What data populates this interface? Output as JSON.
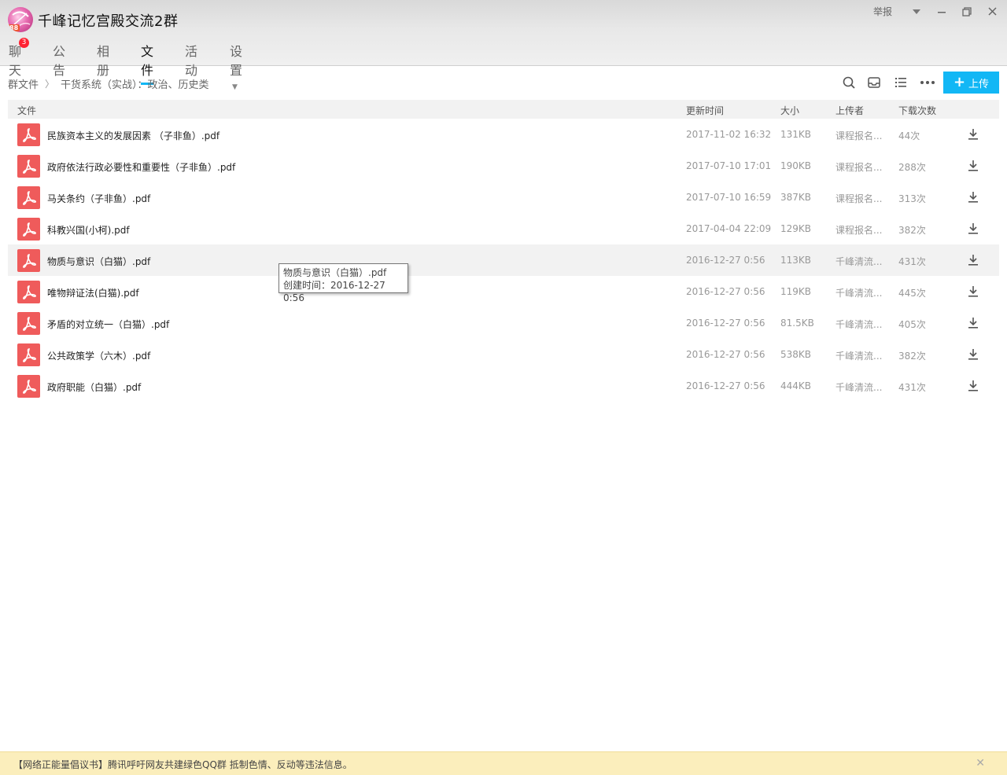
{
  "header": {
    "group_name": "千峰记忆宫殿交流2群",
    "avatar_level": "88",
    "report_label": "举报",
    "tabs": [
      {
        "label": "聊天",
        "badge": "3"
      },
      {
        "label": "公告"
      },
      {
        "label": "相册"
      },
      {
        "label": "文件",
        "active": true
      },
      {
        "label": "活动"
      },
      {
        "label": "设置"
      }
    ]
  },
  "toolbar": {
    "breadcrumb": [
      "群文件",
      "干货系统（实战）：政治、历史类"
    ],
    "upload_label": "上传",
    "accent_color": "#12b7f5"
  },
  "table": {
    "columns": [
      "文件",
      "更新时间",
      "大小",
      "上传者",
      "下载次数"
    ],
    "rows": [
      {
        "name": "民族资本主义的发展因素 （子非鱼）.pdf",
        "time": "2017-11-02 16:32",
        "size": "131KB",
        "uploader": "课程报名...",
        "count": "44次"
      },
      {
        "name": "政府依法行政必要性和重要性（子非鱼）.pdf",
        "time": "2017-07-10 17:01",
        "size": "190KB",
        "uploader": "课程报名...",
        "count": "288次"
      },
      {
        "name": "马关条约（子非鱼）.pdf",
        "time": "2017-07-10 16:59",
        "size": "387KB",
        "uploader": "课程报名...",
        "count": "313次"
      },
      {
        "name": "科教兴国(小柯).pdf",
        "time": "2017-04-04 22:09",
        "size": "129KB",
        "uploader": "课程报名...",
        "count": "382次"
      },
      {
        "name": "物质与意识（白猫）.pdf",
        "time": "2016-12-27 0:56",
        "size": "113KB",
        "uploader": "千峰清流...",
        "count": "431次"
      },
      {
        "name": "唯物辩证法(白猫).pdf",
        "time": "2016-12-27 0:56",
        "size": "119KB",
        "uploader": "千峰清流...",
        "count": "445次"
      },
      {
        "name": "矛盾的对立统一（白猫）.pdf",
        "time": "2016-12-27 0:56",
        "size": "81.5KB",
        "uploader": "千峰清流...",
        "count": "405次"
      },
      {
        "name": "公共政策学（六木）.pdf",
        "time": "2016-12-27 0:56",
        "size": "538KB",
        "uploader": "千峰清流...",
        "count": "382次"
      },
      {
        "name": "政府职能（白猫）.pdf",
        "time": "2016-12-27 0:56",
        "size": "444KB",
        "uploader": "千峰清流...",
        "count": "431次"
      }
    ]
  },
  "tooltip": {
    "line1": "物质与意识（白猫）.pdf",
    "line2": "创建时间：2016-12-27 0:56"
  },
  "notice": {
    "text": "【网络正能量倡议书】腾讯呼吁网友共建绿色QQ群 抵制色情、反动等违法信息。"
  }
}
